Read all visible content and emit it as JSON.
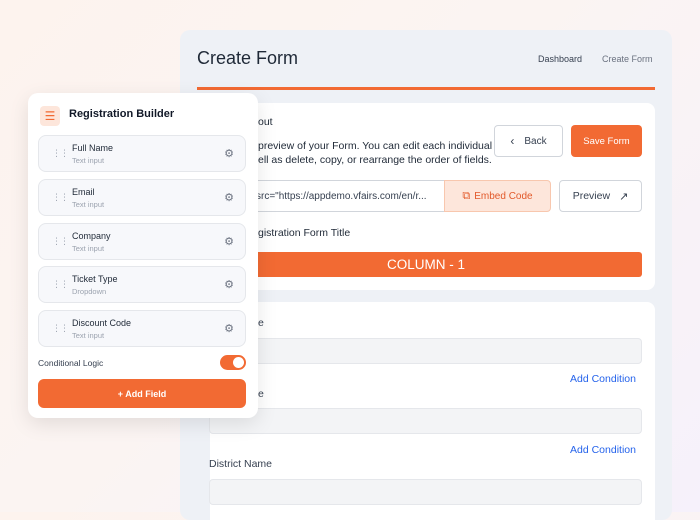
{
  "page": {
    "title": "Create Form",
    "breadcrumb": [
      "Dashboard",
      "Create Form"
    ]
  },
  "layout_card": {
    "heading_partial": "out",
    "desc_line1": "preview of your Form. You can edit each individual",
    "desc_line2": "ell as delete, copy, or rearrange the order of fields.",
    "back_label": "Back",
    "save_label": "Save Form",
    "embed_value": "src=\"https://appdemo.vfairs.com/en/r...",
    "embed_label": "Embed Code",
    "preview_label": "Preview",
    "form_title_partial": "gistration Form Title",
    "column_label": "COLUMN - 1"
  },
  "fields_card": {
    "label1_partial": "e",
    "label2_partial": "e",
    "add_condition_label": "Add Condition",
    "district_label": "District Name"
  },
  "builder": {
    "title": "Registration Builder",
    "items": [
      {
        "name": "Full Name",
        "type": "Text input"
      },
      {
        "name": "Email",
        "type": "Text input"
      },
      {
        "name": "Company",
        "type": "Text input"
      },
      {
        "name": "Ticket Type",
        "type": "Dropdown"
      },
      {
        "name": "Discount Code",
        "type": "Text input"
      }
    ],
    "conditional_logic_label": "Conditional Logic",
    "conditional_logic_on": true,
    "add_field_label": "+ Add Field"
  },
  "colors": {
    "accent": "#f26a33",
    "link": "#2563eb"
  }
}
